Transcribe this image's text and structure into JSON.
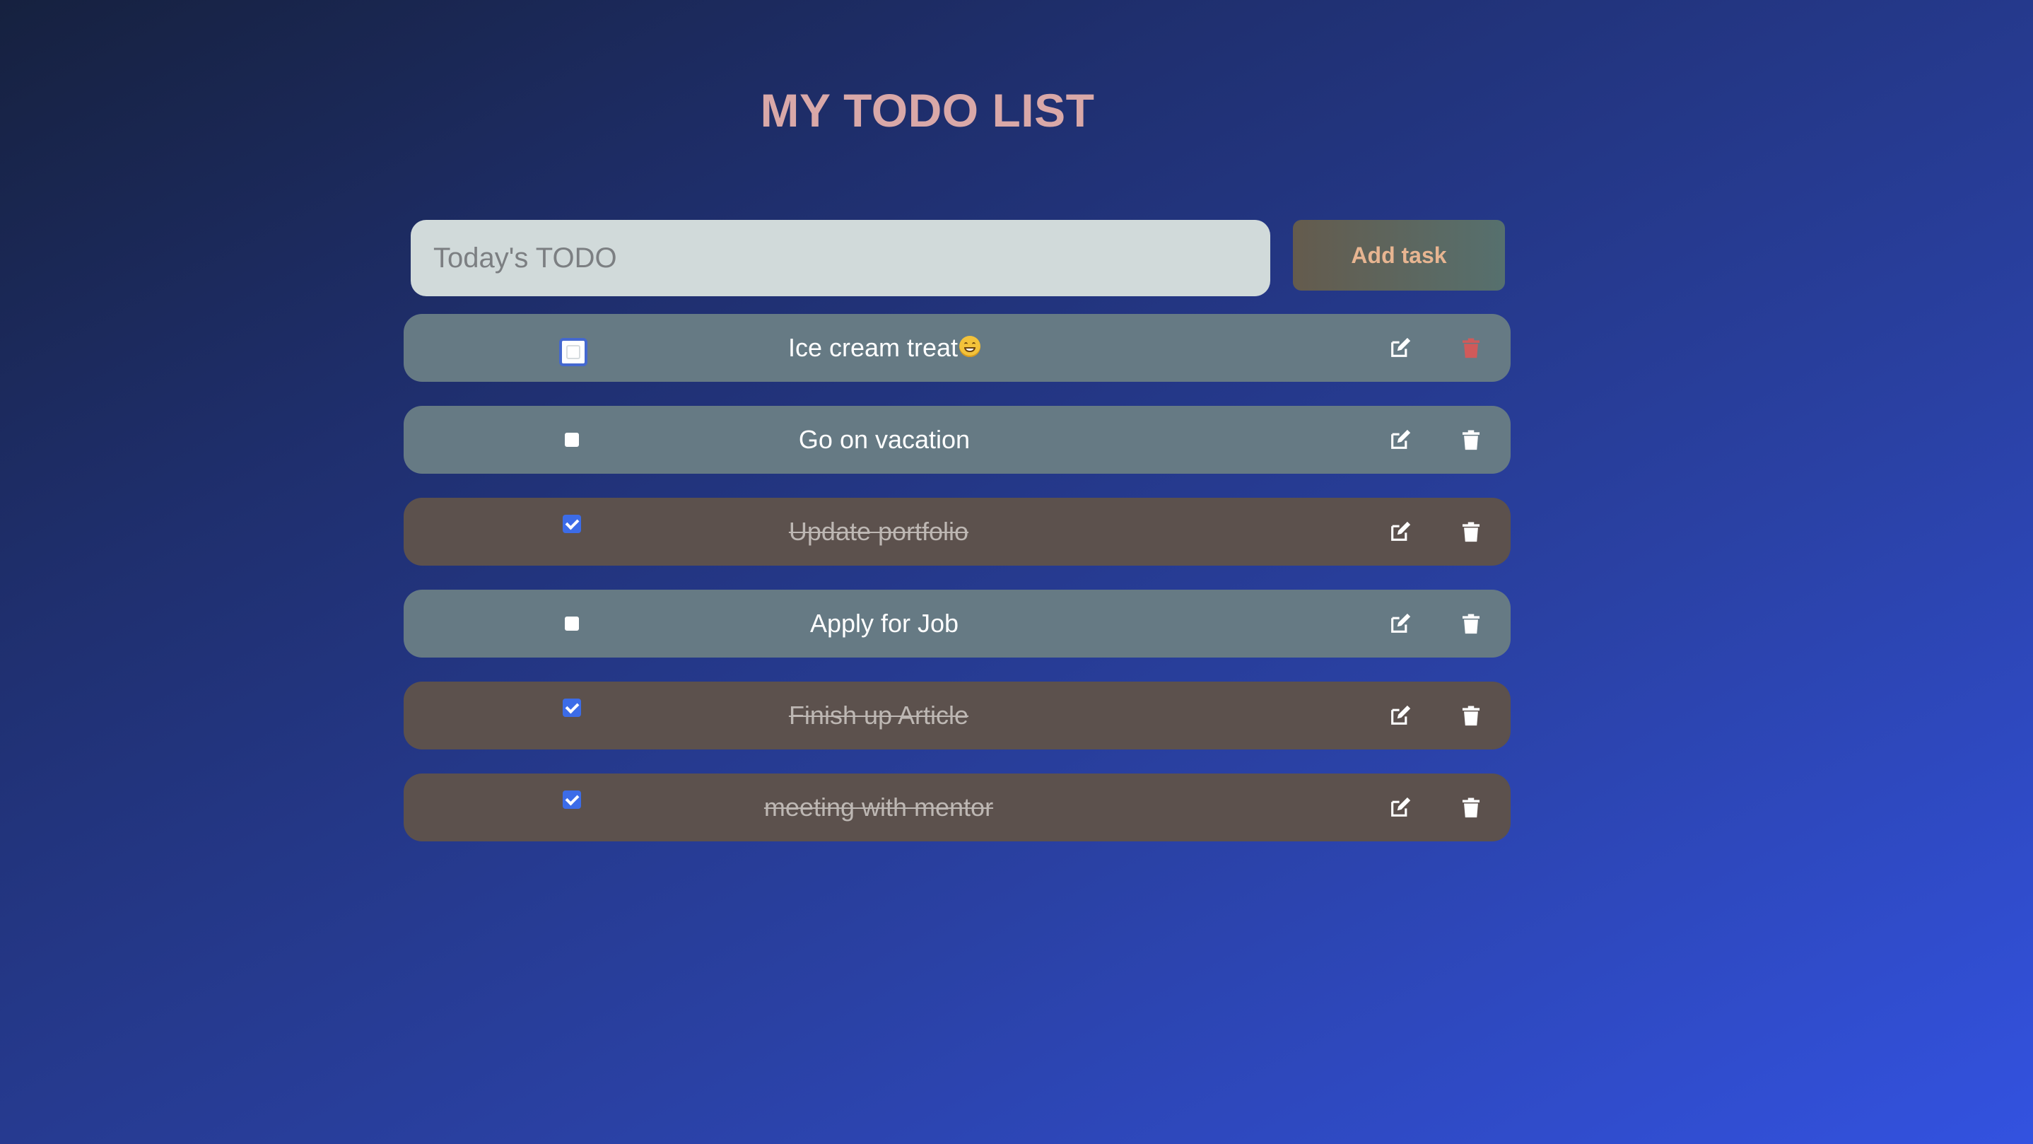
{
  "header": {
    "title": "MY TODO LIST"
  },
  "form": {
    "input_placeholder": "Today's TODO",
    "input_value": "",
    "add_label": "Add task"
  },
  "todos": [
    {
      "text": "Ice cream treat",
      "emoji": "grinning-face-icon",
      "completed": false,
      "focused": true,
      "delete_icon_color": "#d05a5a"
    },
    {
      "text": "Go on vacation",
      "completed": false
    },
    {
      "text": "Update portfolio",
      "completed": true
    },
    {
      "text": "Apply for Job",
      "completed": false
    },
    {
      "text": "Finish up Article",
      "completed": true
    },
    {
      "text": "meeting with mentor",
      "completed": true
    }
  ],
  "icons": {
    "edit": "edit-icon",
    "delete": "trash-icon"
  },
  "colors": {
    "title": "#d9a8a8",
    "pending_row": "#667a84",
    "completed_row": "#5c514d",
    "checkbox_checked": "#3c6ce8",
    "add_button_text": "#e7b591"
  }
}
